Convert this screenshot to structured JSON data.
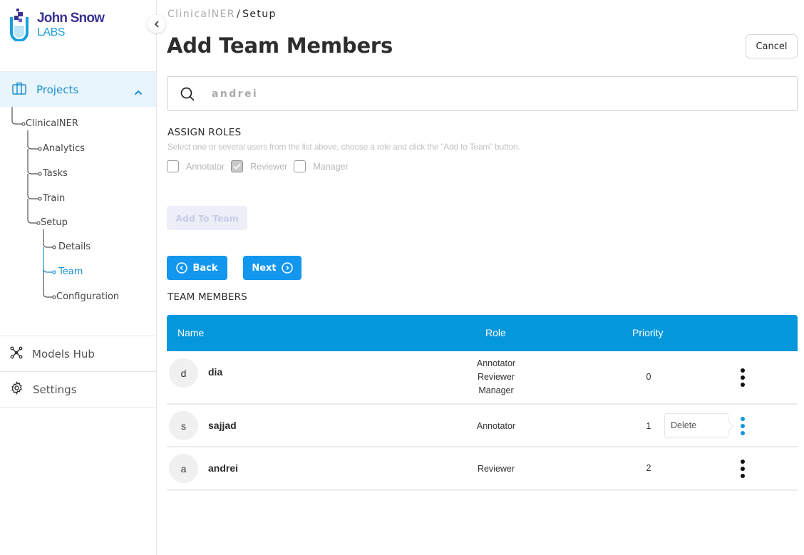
{
  "brand": {
    "name_line1": "John Snow",
    "name_line2": "LABS",
    "primary_color": "#3a3393",
    "accent_color": "#1aa0e0"
  },
  "sidebar": {
    "collapse_icon": "chevron-left-icon",
    "projects": {
      "label": "Projects",
      "icon": "briefcase-icon",
      "expanded": true
    },
    "tree": {
      "project": "ClinicalNER",
      "items": [
        {
          "label": "Analytics",
          "active": false
        },
        {
          "label": "Tasks",
          "active": false
        },
        {
          "label": "Train",
          "active": false
        },
        {
          "label": "Setup",
          "active": false
        }
      ],
      "setup_children": [
        {
          "label": "Details",
          "active": false
        },
        {
          "label": "Team",
          "active": true
        },
        {
          "label": "Configuration",
          "active": false
        }
      ]
    },
    "bottom_items": [
      {
        "label": "Models Hub",
        "icon": "network-icon"
      },
      {
        "label": "Settings",
        "icon": "gear-icon"
      }
    ]
  },
  "header": {
    "breadcrumb": [
      "ClinicalNER",
      "Setup"
    ],
    "breadcrumb_separator": "/",
    "title": "Add Team Members",
    "cancel_label": "Cancel"
  },
  "search": {
    "value": "andrei",
    "placeholder": ""
  },
  "assign_roles": {
    "title": "ASSIGN ROLES",
    "help": "Select one or several users from the list above, choose a role and click the “Add to Team” button.",
    "roles": [
      {
        "label": "Annotator",
        "checked": false
      },
      {
        "label": "Reviewer",
        "checked": true
      },
      {
        "label": "Manager",
        "checked": false
      }
    ],
    "add_button_label": "Add To Team",
    "add_button_disabled": true
  },
  "wizard": {
    "back_label": "Back",
    "next_label": "Next"
  },
  "team": {
    "title": "TEAM MEMBERS",
    "columns": [
      "Name",
      "Role",
      "Priority"
    ],
    "members": [
      {
        "initial": "d",
        "name": "dia",
        "roles": [
          "Annotator",
          "Reviewer",
          "Manager"
        ],
        "priority": "0",
        "menu_open": false
      },
      {
        "initial": "s",
        "name": "sajjad",
        "roles": [
          "Annotator"
        ],
        "priority": "1",
        "menu_open": true
      },
      {
        "initial": "a",
        "name": "andrei",
        "roles": [
          "Reviewer"
        ],
        "priority": "2",
        "menu_open": false
      }
    ],
    "row_menu": {
      "delete_label": "Delete"
    },
    "header_color": "#0497db"
  }
}
